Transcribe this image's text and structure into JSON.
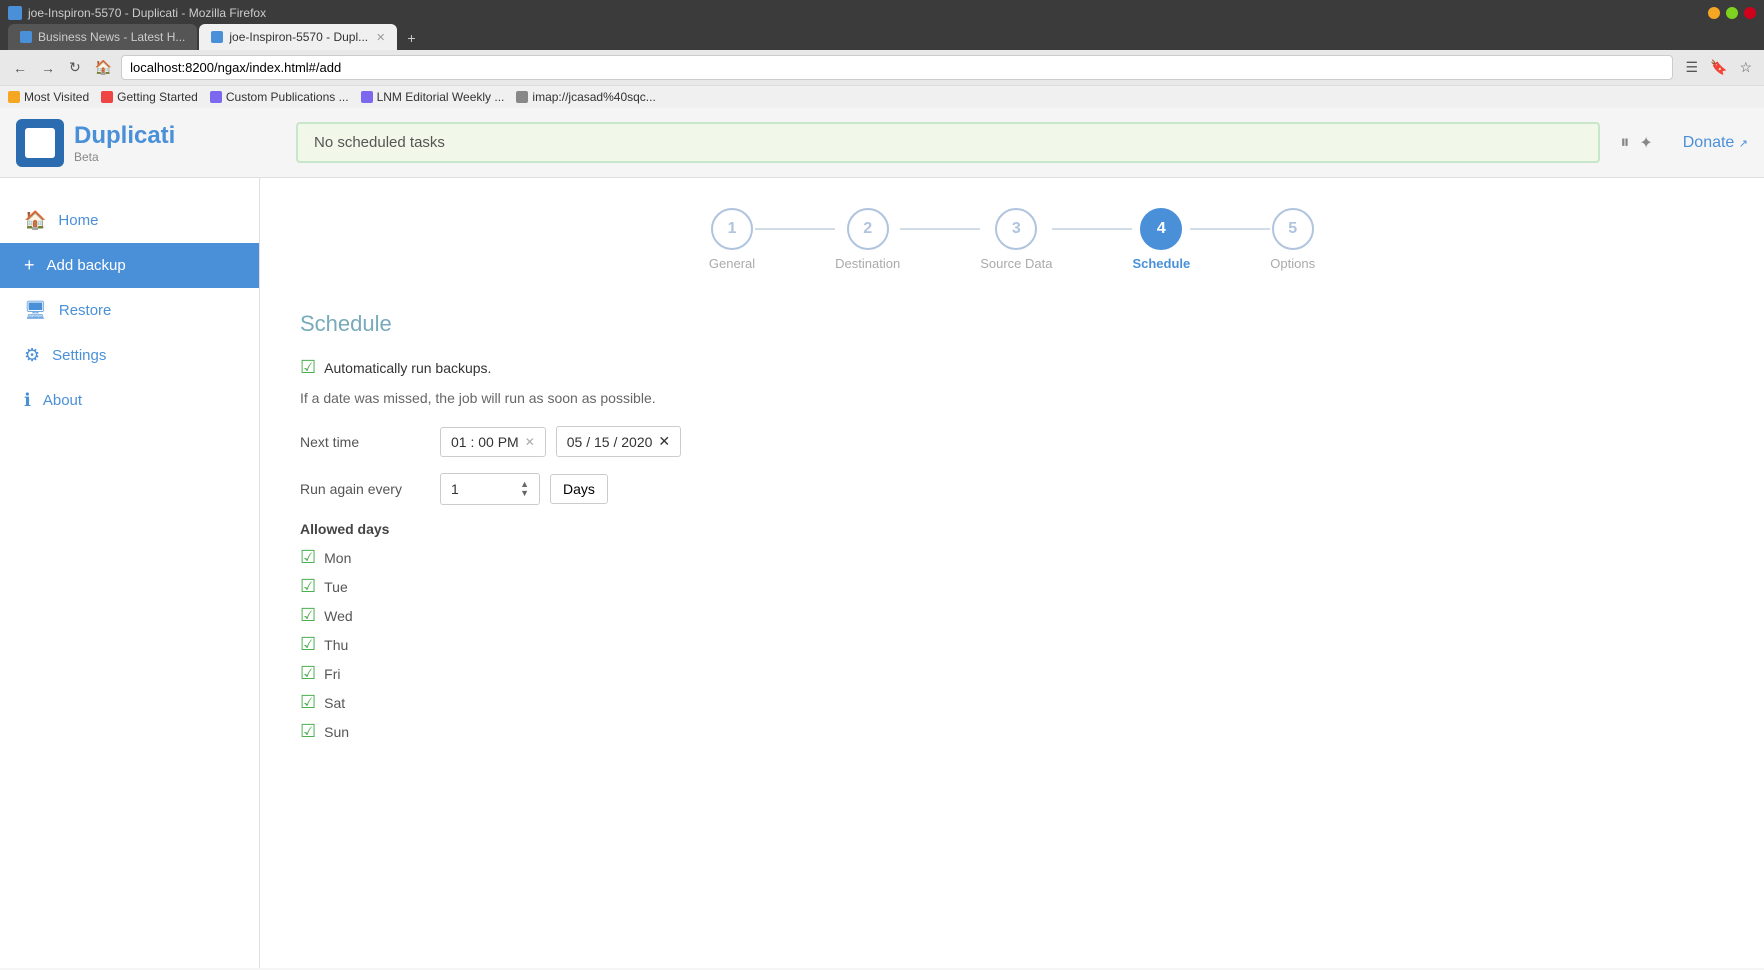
{
  "browser": {
    "title": "joe-Inspiron-5570 - Duplicati - Mozilla Firefox",
    "tab1_label": "Business News - Latest H...",
    "tab2_label": "joe-Inspiron-5570 - Dupl...",
    "address": "localhost:8200/ngax/index.html#/add",
    "bookmarks": [
      {
        "label": "Most Visited",
        "type": "star"
      },
      {
        "label": "Getting Started",
        "type": "fire"
      },
      {
        "label": "Custom Publications ...",
        "type": "doc"
      },
      {
        "label": "LNM Editorial Weekly ...",
        "type": "doc"
      },
      {
        "label": "imap://jcasad%40sqc...",
        "type": "globe"
      }
    ]
  },
  "header": {
    "logo_name": "Duplicati",
    "logo_beta": "Beta",
    "status_message": "No scheduled tasks",
    "donate_label": "Donate"
  },
  "sidebar": {
    "items": [
      {
        "label": "Home",
        "icon": "🏠",
        "active": false
      },
      {
        "label": "Add backup",
        "icon": "+",
        "active": true
      },
      {
        "label": "Restore",
        "icon": "🖥",
        "active": false
      },
      {
        "label": "Settings",
        "icon": "⚙",
        "active": false
      },
      {
        "label": "About",
        "icon": "ℹ",
        "active": false
      }
    ]
  },
  "wizard": {
    "steps": [
      {
        "number": "1",
        "label": "General",
        "active": false
      },
      {
        "number": "2",
        "label": "Destination",
        "active": false
      },
      {
        "number": "3",
        "label": "Source Data",
        "active": false
      },
      {
        "number": "4",
        "label": "Schedule",
        "active": true
      },
      {
        "number": "5",
        "label": "Options",
        "active": false
      }
    ]
  },
  "schedule": {
    "title": "Schedule",
    "auto_run_label": "Automatically run backups.",
    "missed_job_text": "If a date was missed, the job will run as soon as possible.",
    "next_time_label": "Next time",
    "time_value": "01 : 00  PM",
    "date_value": "05 / 15 / 2020",
    "run_again_label": "Run again every",
    "interval_value": "1",
    "interval_unit": "Days",
    "allowed_days_title": "Allowed days",
    "days": [
      {
        "label": "Mon",
        "checked": true
      },
      {
        "label": "Tue",
        "checked": true
      },
      {
        "label": "Wed",
        "checked": true
      },
      {
        "label": "Thu",
        "checked": true
      },
      {
        "label": "Fri",
        "checked": true
      },
      {
        "label": "Sat",
        "checked": true
      },
      {
        "label": "Sun",
        "checked": true
      }
    ]
  }
}
